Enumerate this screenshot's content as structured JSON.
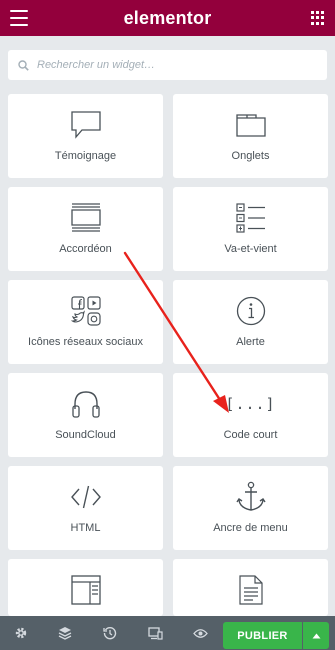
{
  "header": {
    "title": "elementor",
    "menu_icon": "hamburger-icon",
    "apps_icon": "grid-icon"
  },
  "search": {
    "placeholder": "Rechercher un widget…"
  },
  "widgets": [
    {
      "label": "Témoignage",
      "icon": "speech-bubble-icon"
    },
    {
      "label": "Onglets",
      "icon": "tabs-icon"
    },
    {
      "label": "Accordéon",
      "icon": "accordion-icon"
    },
    {
      "label": "Va-et-vient",
      "icon": "toggle-list-icon"
    },
    {
      "label": "Icônes réseaux sociaux",
      "icon": "social-icons-icon"
    },
    {
      "label": "Alerte",
      "icon": "info-circle-icon"
    },
    {
      "label": "SoundCloud",
      "icon": "headphones-icon"
    },
    {
      "label": "Code court",
      "icon": "shortcode-icon",
      "icon_text": "[...]"
    },
    {
      "label": "HTML",
      "icon": "code-brackets-icon"
    },
    {
      "label": "Ancre de menu",
      "icon": "anchor-icon"
    },
    {
      "label": "",
      "icon": "sidebar-layout-icon"
    },
    {
      "label": "",
      "icon": "document-icon"
    }
  ],
  "footer": {
    "publish_label": "PUBLIER",
    "icons": [
      "settings-icon",
      "layers-icon",
      "history-icon",
      "responsive-icon",
      "preview-eye-icon"
    ]
  },
  "colors": {
    "header": "#93003c",
    "publish": "#39b54a",
    "footer": "#556068",
    "annotation_arrow": "#e8221c"
  }
}
